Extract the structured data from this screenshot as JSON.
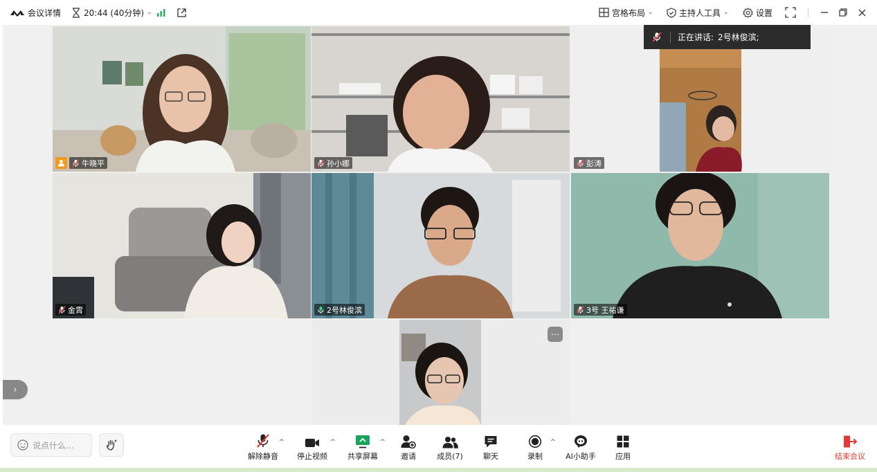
{
  "topbar": {
    "meeting_details": "会议详情",
    "timer": "20:44 (40分钟)",
    "layout": "宫格布局",
    "host_tools": "主持人工具",
    "settings": "设置"
  },
  "speaking_banner": {
    "label": "正在讲话:",
    "speaker": "2号林俊滨;"
  },
  "participants": [
    {
      "name": "牛晓平",
      "muted": true,
      "host": true
    },
    {
      "name": "孙小娜",
      "muted": true
    },
    {
      "name": "彭涛",
      "muted": true
    },
    {
      "name": "金霄",
      "muted": true
    },
    {
      "name": "2号林俊滨",
      "muted": false,
      "speaking": true
    },
    {
      "name": "3号 王祐谦",
      "muted": true
    },
    {
      "name": "",
      "muted": false
    }
  ],
  "chat": {
    "placeholder": "说点什么..."
  },
  "toolbar": {
    "unmute": "解除静音",
    "stop_video": "停止视频",
    "share_screen": "共享屏幕",
    "invite": "邀请",
    "members": "成员(7)",
    "chat": "聊天",
    "record": "录制",
    "ai_assistant": "AI小助手",
    "apps": "应用",
    "end_meeting": "结束会议"
  },
  "colors": {
    "accent_green": "#3ccf8e",
    "end_red": "#e53935",
    "share_green": "#1aa35a",
    "host_orange": "#f29a1b"
  }
}
